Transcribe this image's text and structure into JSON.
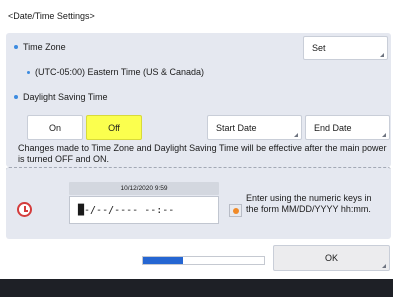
{
  "title": "<Date/Time Settings>",
  "time_zone": {
    "label": "Time Zone",
    "set_label": "Set",
    "value": "(UTC-05:00) Eastern Time (US & Canada)"
  },
  "dst": {
    "label": "Daylight Saving Time",
    "on_label": "On",
    "off_label": "Off",
    "selected": "Off",
    "start_date_label": "Start Date",
    "end_date_label": "End Date"
  },
  "notice": "Changes made to Time Zone and Daylight Saving Time will be effective after the main power is turned OFF and ON.",
  "datetime": {
    "current": "10/12/2020 9:59",
    "input_value": "█-/--/---- --:--",
    "hint": "Enter using the numeric keys in the form MM/DD/YYYY hh:mm."
  },
  "progress": {
    "fraction": 0.33
  },
  "ok_label": "OK",
  "colors": {
    "accent": "#3c8be0",
    "selected": "#fbff4e",
    "progress": "#2566d2"
  },
  "icons": {
    "clock": "clock-icon",
    "hint": "hint-icon"
  }
}
